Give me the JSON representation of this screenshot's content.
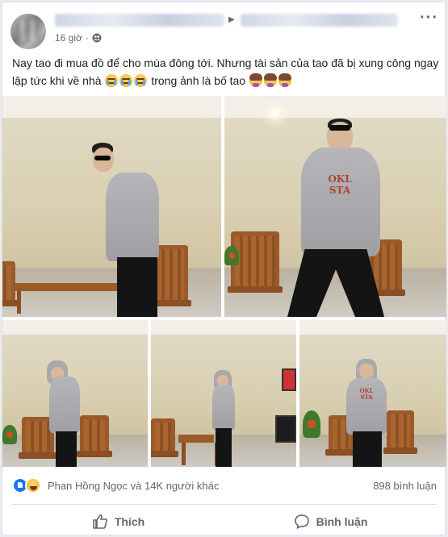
{
  "post": {
    "time": "16 giờ",
    "privacy_icon": "friends-icon",
    "text_main": "Nay tao đi mua đồ để cho mùa đông tới. Nhưng tài sản của tao đã bị xung công ngay lập tức khi về nhà",
    "text_after": "trong ảnh là bố tao",
    "emoji_cry": "loudly-crying-face-icon",
    "emoji_facepalm": "woman-facepalming-icon"
  },
  "stats": {
    "reactions_text": "Phan Hồng Ngọc và 14K người khác",
    "comments_text": "898 bình luận"
  },
  "actions": {
    "like_label": "Thích",
    "comment_label": "Bình luận"
  },
  "colors": {
    "like_blue": "#1877f2",
    "text_gray": "#606770"
  }
}
